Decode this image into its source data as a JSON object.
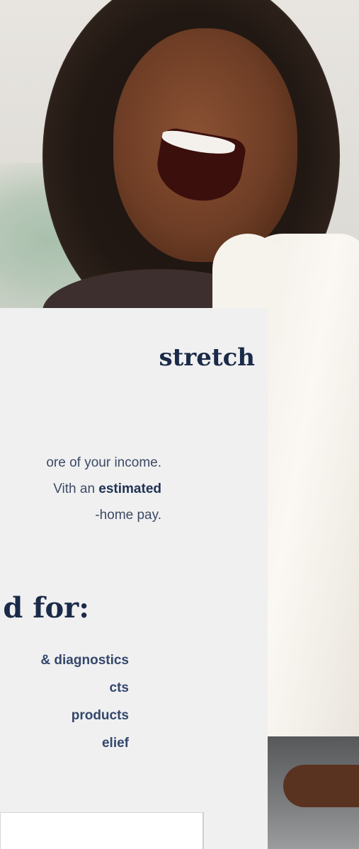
{
  "hero": {
    "image_alt": "Smiling woman with a white towel around her neck"
  },
  "card": {
    "heading": "stretch",
    "paragraph": {
      "line1": "ore of your income.",
      "line2_prefix": "Vith an ",
      "line2_bold": "estimated",
      "line3": "-home pay."
    },
    "subheading": "d for:",
    "list_items": [
      "& diagnostics",
      "cts",
      "products",
      "elief"
    ]
  },
  "colors": {
    "card_bg": "#f0f0f1",
    "heading": "#1a2a48",
    "body_text": "#3c4a63",
    "list_text": "#34476b"
  }
}
